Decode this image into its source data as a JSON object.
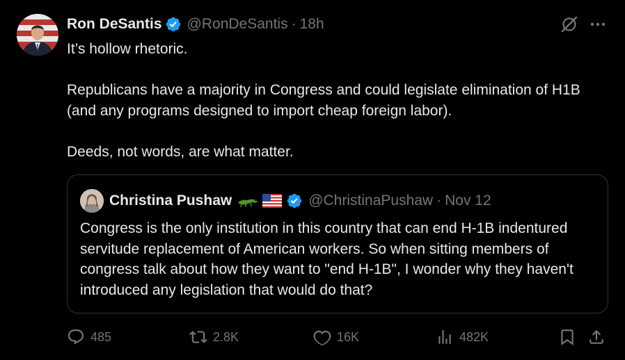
{
  "author": {
    "name": "Ron DeSantis",
    "handle": "@RonDeSantis",
    "separator": "·",
    "time": "18h"
  },
  "body": {
    "paragraphs": [
      "It’s hollow rhetoric.",
      "Republicans have a majority in Congress and could legislate elimination of H1B (and any programs designed to import cheap foreign labor).",
      "Deeds, not words, are what matter."
    ]
  },
  "quoted": {
    "name": "Christina Pushaw",
    "emojis": [
      "alligator-emoji",
      "us-flag-emoji"
    ],
    "handle": "@ChristinaPushaw",
    "separator": "·",
    "time": "Nov 12",
    "text": "Congress is the only institution in this country that can end H-1B indentured servitude replacement of American workers. So when sitting members of congress talk about how they want to \"end H-1B\", I wonder why they haven't introduced any legislation that would do that?"
  },
  "actions": {
    "replies": "485",
    "reposts": "2.8K",
    "likes": "16K",
    "views": "482K"
  },
  "colors": {
    "background": "#000000",
    "text": "#e7e9ea",
    "muted": "#71767b",
    "verified": "#1d9bf0",
    "border": "#2f3336"
  },
  "icons": [
    "verified-badge-icon",
    "grok-icon",
    "more-icon",
    "reply-icon",
    "repost-icon",
    "like-icon",
    "views-icon",
    "bookmark-icon",
    "share-icon"
  ]
}
